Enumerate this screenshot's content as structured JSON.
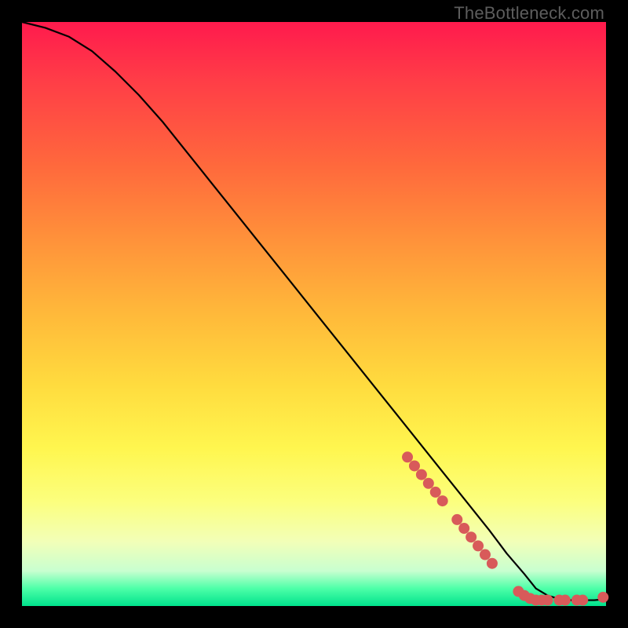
{
  "watermark": "TheBottleneck.com",
  "chart_data": {
    "type": "line",
    "title": "",
    "xlabel": "",
    "ylabel": "",
    "xlim": [
      0,
      100
    ],
    "ylim": [
      0,
      100
    ],
    "grid": false,
    "series": [
      {
        "name": "curve",
        "color": "#000000",
        "x": [
          0,
          4,
          8,
          12,
          16,
          20,
          24,
          28,
          32,
          36,
          40,
          44,
          48,
          52,
          56,
          60,
          64,
          68,
          72,
          76,
          80,
          83,
          86,
          88,
          90,
          92,
          94,
          96,
          98,
          100
        ],
        "y": [
          100,
          99,
          97.5,
          95,
          91.5,
          87.5,
          83,
          78,
          73,
          68,
          63,
          58,
          53,
          48,
          43,
          38,
          33,
          28,
          23,
          18,
          13,
          9,
          5.5,
          3,
          1.8,
          1.2,
          1.0,
          1.0,
          1.0,
          1.2
        ]
      }
    ],
    "markers": [
      {
        "name": "dots",
        "color": "#d85a5a",
        "points": [
          {
            "x": 66,
            "y": 25.5
          },
          {
            "x": 67.2,
            "y": 24
          },
          {
            "x": 68.4,
            "y": 22.5
          },
          {
            "x": 69.6,
            "y": 21
          },
          {
            "x": 70.8,
            "y": 19.5
          },
          {
            "x": 72,
            "y": 18
          },
          {
            "x": 74.5,
            "y": 14.8
          },
          {
            "x": 75.7,
            "y": 13.3
          },
          {
            "x": 76.9,
            "y": 11.8
          },
          {
            "x": 78.1,
            "y": 10.3
          },
          {
            "x": 79.3,
            "y": 8.8
          },
          {
            "x": 80.5,
            "y": 7.3
          },
          {
            "x": 85,
            "y": 2.5
          },
          {
            "x": 86,
            "y": 1.8
          },
          {
            "x": 87,
            "y": 1.3
          },
          {
            "x": 88,
            "y": 1.0
          },
          {
            "x": 89,
            "y": 1.0
          },
          {
            "x": 90,
            "y": 1.0
          },
          {
            "x": 92,
            "y": 1.0
          },
          {
            "x": 93,
            "y": 1.0
          },
          {
            "x": 95,
            "y": 1.0
          },
          {
            "x": 96,
            "y": 1.0
          },
          {
            "x": 99.5,
            "y": 1.5
          }
        ]
      }
    ]
  }
}
